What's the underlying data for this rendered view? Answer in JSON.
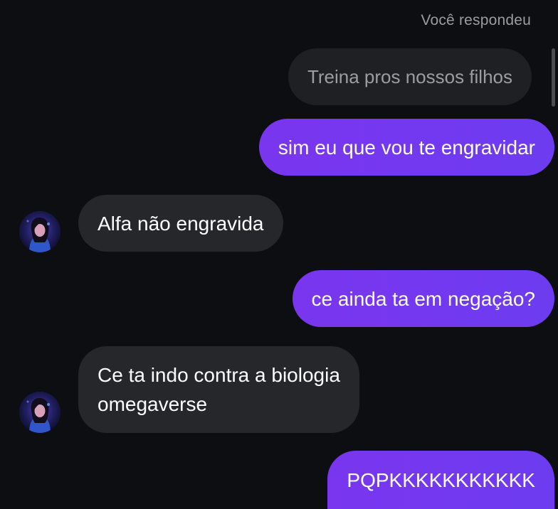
{
  "reply": {
    "label": "Você respondeu",
    "quoted_text": "Treina pros nossos filhos"
  },
  "messages": [
    {
      "direction": "out",
      "text": "sim eu que vou te engravidar"
    },
    {
      "direction": "in",
      "text": "Alfa não engravida",
      "avatar": "contact-avatar"
    },
    {
      "direction": "out",
      "text": "ce ainda ta em negação?"
    },
    {
      "direction": "in",
      "lines": [
        "Ce ta indo contra a biologia",
        "omegaverse"
      ],
      "avatar": "contact-avatar"
    },
    {
      "direction": "out",
      "text": "PQPKKKKKKKKKKK"
    }
  ],
  "colors": {
    "background": "#0d0e12",
    "outgoing_bubble": "#7036ef",
    "incoming_bubble": "#25272b",
    "quoted_bubble": "#1f2024",
    "muted_text": "#9a9ca2"
  }
}
